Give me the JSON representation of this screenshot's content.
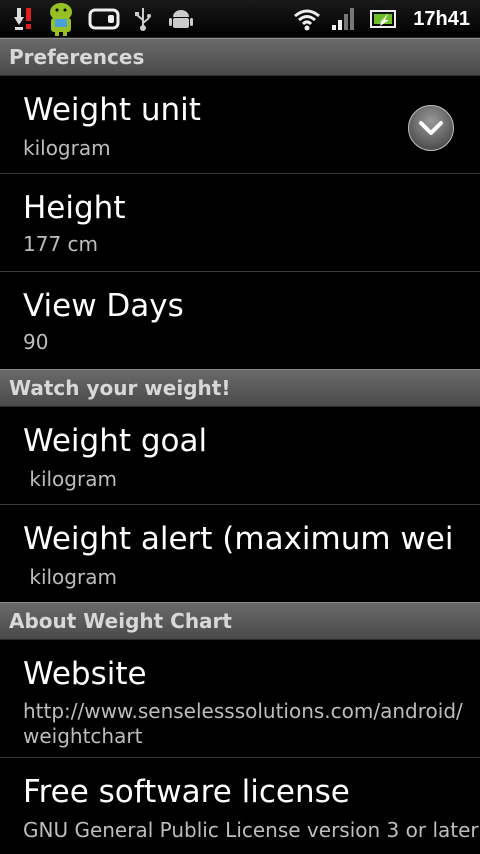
{
  "status_bar": {
    "time": "17h41",
    "icons": [
      "download-icon",
      "android-bot-icon",
      "toggle-icon",
      "usb-icon",
      "android-debug-icon",
      "wifi-icon",
      "signal-icon",
      "battery-icon"
    ]
  },
  "sections": {
    "preferences": "Preferences",
    "watch": "Watch your weight!",
    "about": "About Weight Chart"
  },
  "prefs": {
    "weight_unit": {
      "title": "Weight unit",
      "summary": "kilogram"
    },
    "height": {
      "title": "Height",
      "summary": "177 cm"
    },
    "view_days": {
      "title": "View Days",
      "summary": "90"
    },
    "weight_goal": {
      "title": "Weight goal",
      "summary": " kilogram"
    },
    "weight_alert": {
      "title": "Weight alert (maximum weig",
      "summary": " kilogram"
    },
    "website": {
      "title": "Website",
      "summary": "http://www.senselesssolutions.com/android/weightchart"
    },
    "license": {
      "title": "Free software license",
      "summary": "GNU General Public License version 3 or later"
    }
  }
}
